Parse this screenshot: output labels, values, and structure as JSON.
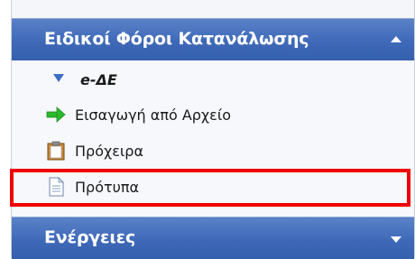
{
  "panel": {
    "header": {
      "title": "Ειδικοί Φόροι Κατανάλωσης",
      "state_icon": "chevron-up-icon"
    },
    "items": [
      {
        "label": "e-ΔΕ",
        "icon": "triangle-down-icon"
      },
      {
        "label": "Εισαγωγή από Αρχείο",
        "icon": "arrow-right-icon"
      },
      {
        "label": "Πρόχειρα",
        "icon": "clipboard-icon"
      },
      {
        "label": "Πρότυπα",
        "icon": "document-icon",
        "highlighted": true
      }
    ],
    "actions_header": {
      "title": "Ενέργειες",
      "state_icon": "chevron-down-icon"
    }
  },
  "colors": {
    "header_bg": "#4370bb",
    "header_text": "#ffffff",
    "highlight_border": "#f00000",
    "arrow_green": "#2db82d"
  }
}
